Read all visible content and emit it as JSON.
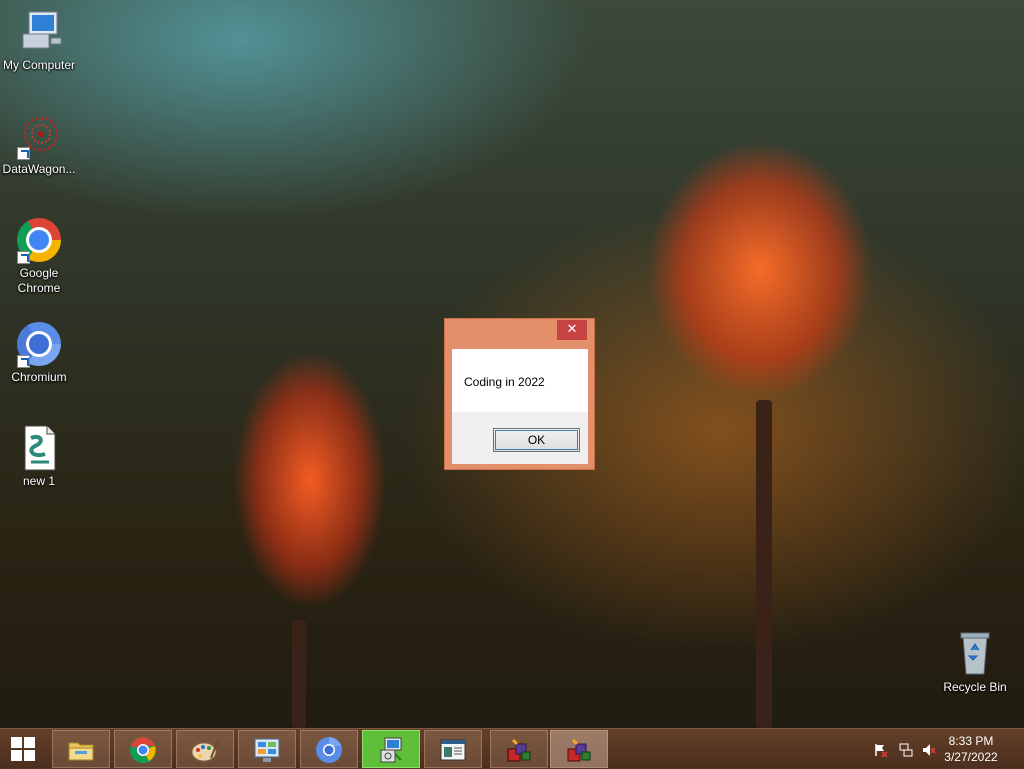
{
  "desktop": {
    "icons": [
      {
        "label": "My Computer",
        "icon": "computer-icon"
      },
      {
        "label": "DataWagon...",
        "icon": "datawagon-icon"
      },
      {
        "label": "Google Chrome",
        "icon": "chrome-icon"
      },
      {
        "label": "Chromium",
        "icon": "chromium-icon"
      },
      {
        "label": "new 1",
        "icon": "document-icon"
      },
      {
        "label": "Recycle Bin",
        "icon": "recycle-bin-icon"
      }
    ]
  },
  "dialog": {
    "message": "Coding in 2022",
    "ok_label": "OK",
    "close_glyph": "✕"
  },
  "taskbar": {
    "buttons": [
      {
        "name": "file-explorer",
        "icon": "folder-icon"
      },
      {
        "name": "google-chrome",
        "icon": "chrome-icon"
      },
      {
        "name": "paint",
        "icon": "palette-icon"
      },
      {
        "name": "control-panel",
        "icon": "control-panel-icon"
      },
      {
        "name": "chromium",
        "icon": "chromium-icon"
      },
      {
        "name": "installer",
        "icon": "installer-icon",
        "highlight": "#5fbf3a"
      },
      {
        "name": "window-app",
        "icon": "window-icon"
      },
      {
        "name": "app-1",
        "icon": "blocks-icon"
      },
      {
        "name": "app-2",
        "icon": "blocks-icon"
      }
    ],
    "tray": {
      "icons": [
        "action-center-flag-icon",
        "network-icon",
        "volume-muted-icon"
      ],
      "time": "8:33 PM",
      "date": "3/27/2022"
    }
  },
  "colors": {
    "dialog_frame": "#e3906a",
    "close_button": "#c74242",
    "taskbar": "#6e462d"
  }
}
